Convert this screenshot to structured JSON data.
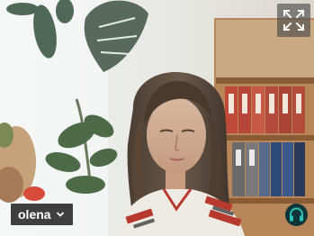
{
  "participant": {
    "name": "olena"
  },
  "colors": {
    "audio_indicator": "#27c3b8",
    "name_tag_bg": "#1c1c1c",
    "fullscreen_bg": "#464646"
  },
  "icons": {
    "fullscreen": "expand-arrows-icon",
    "menu": "chevron-down-icon",
    "audio": "headphones-icon"
  }
}
